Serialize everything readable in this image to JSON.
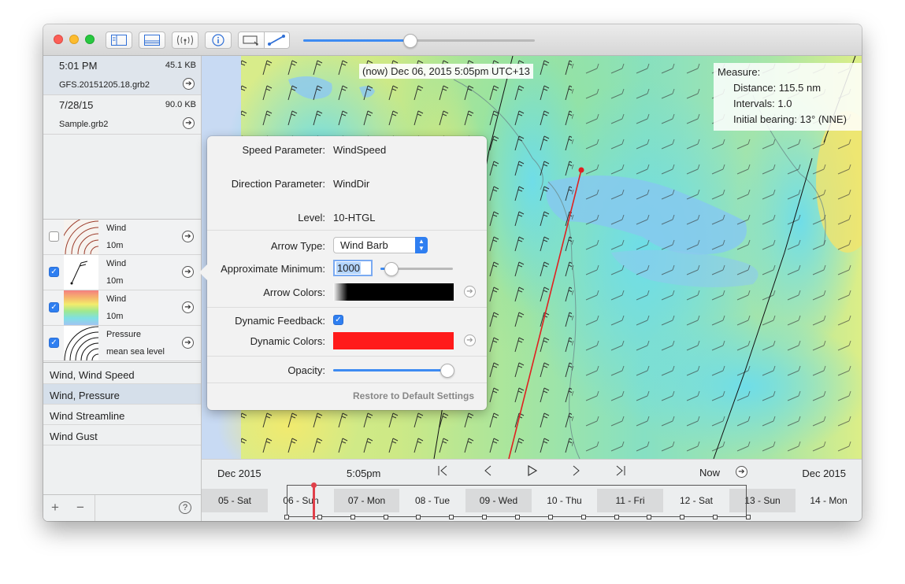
{
  "toolbar": {
    "buttons": [
      {
        "name": "sidebar-toggle-icon"
      },
      {
        "name": "bottom-panel-toggle-icon"
      },
      {
        "name": "broadcast-icon"
      },
      {
        "name": "info-icon"
      }
    ],
    "measure_tools": [
      "select-area-icon",
      "measure-line-icon"
    ],
    "slider_value": 0.46
  },
  "files": [
    {
      "time": "5:01 PM",
      "size": "45.1 KB",
      "name": "GFS.20151205.18.grb2",
      "selected": true
    },
    {
      "time": "7/28/15",
      "size": "90.0 KB",
      "name": "Sample.grb2",
      "selected": false
    }
  ],
  "layers": [
    {
      "line1": "Wind",
      "line2": "10m",
      "checked": false,
      "thumb": "isolines-icon"
    },
    {
      "line1": "Wind",
      "line2": "10m",
      "checked": true,
      "thumb": "wind-barb-icon"
    },
    {
      "line1": "Wind",
      "line2": "10m",
      "checked": true,
      "thumb": "color-gradient-icon"
    },
    {
      "line1": "Pressure",
      "line2": "mean sea level",
      "checked": true,
      "thumb": "isobars-icon"
    }
  ],
  "presets": [
    {
      "label": "Wind, Wind Speed",
      "selected": false
    },
    {
      "label": "Wind, Pressure",
      "selected": true
    },
    {
      "label": "Wind Streamline",
      "selected": false
    },
    {
      "label": "Wind Gust",
      "selected": false
    }
  ],
  "sidebar_footer": {
    "add": "+",
    "remove": "−",
    "help": "?"
  },
  "map": {
    "now_label": "(now) Dec 06, 2015 5:05pm UTC+13",
    "measure": {
      "title": "Measure:",
      "distance": "Distance: 115.5 nm",
      "intervals": "Intervals: 1.0",
      "bearing": "Initial bearing: 13° (NNE)"
    }
  },
  "popover": {
    "speed_label": "Speed Parameter:",
    "speed_value": "WindSpeed",
    "direction_label": "Direction Parameter:",
    "direction_value": "WindDir",
    "level_label": "Level:",
    "level_value": "10-HTGL",
    "arrow_type_label": "Arrow Type:",
    "arrow_type_value": "Wind Barb",
    "approx_min_label": "Approximate Minimum:",
    "approx_min_value": "1000",
    "approx_min_slider": 0.14,
    "arrow_colors_label": "Arrow Colors:",
    "dynamic_feedback_label": "Dynamic Feedback:",
    "dynamic_feedback_checked": true,
    "dynamic_colors_label": "Dynamic Colors:",
    "dynamic_color": "#ff1a1a",
    "opacity_label": "Opacity:",
    "opacity_value": 1.0,
    "restore_label": "Restore to Default Settings"
  },
  "timeline": {
    "left_date": "Dec 2015",
    "time": "5:05pm",
    "now_label": "Now",
    "right_date": "Dec 2015",
    "days": [
      "05 - Sat",
      "06 - Sun",
      "07 - Mon",
      "08 - Tue",
      "09 - Wed",
      "10 - Thu",
      "11 - Fri",
      "12 - Sat",
      "13 - Sun",
      "14 - Mon"
    ]
  },
  "colors": {
    "accent": "#2f7ff1",
    "measure_line": "#e02020",
    "cursor": "#e0404a"
  }
}
